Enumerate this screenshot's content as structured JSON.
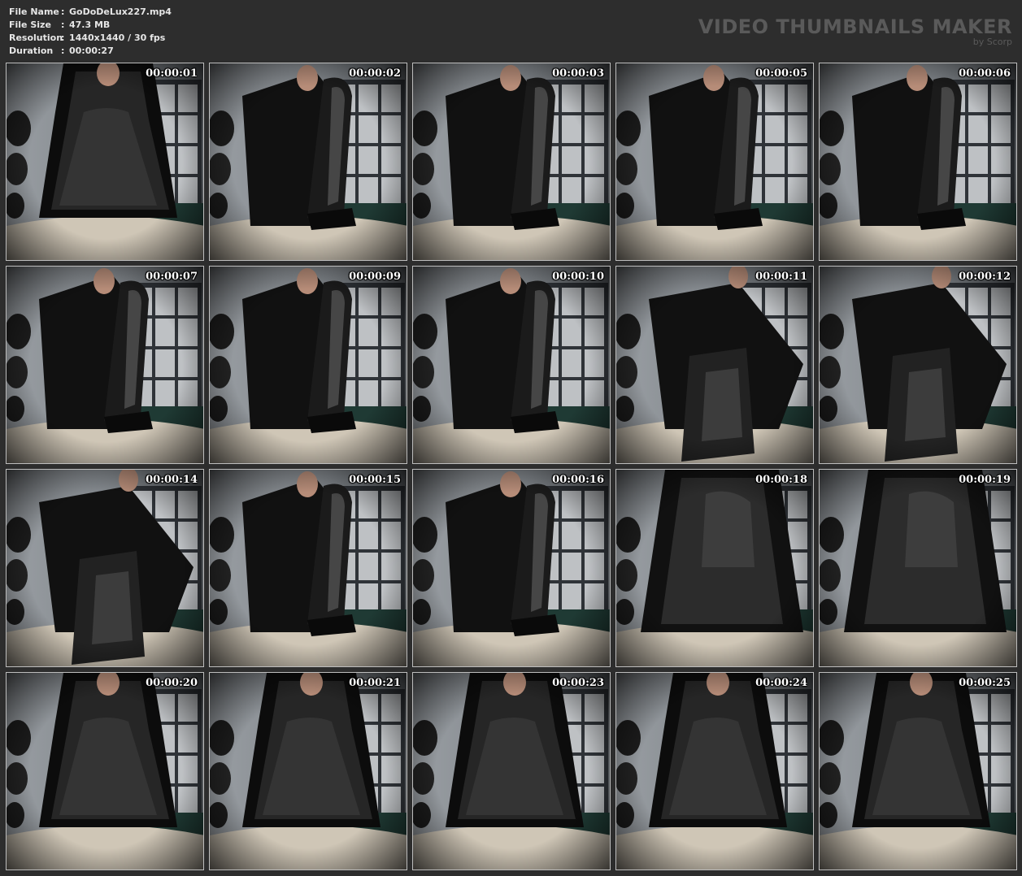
{
  "file_info": {
    "rows": [
      {
        "label": "File Name",
        "sep": ":",
        "value": "GoDoDeLux227.mp4"
      },
      {
        "label": "File Size",
        "sep": ":",
        "value": "47.3 MB"
      },
      {
        "label": "Resolution",
        "sep": ":",
        "value": "1440x1440 / 30 fps"
      },
      {
        "label": "Duration",
        "sep": ":",
        "value": "00:00:27"
      }
    ]
  },
  "brand": {
    "title": "VIDEO THUMBNAILS MAKER",
    "subtitle": "by Scorp"
  },
  "thumbnails": [
    {
      "timestamp": "00:00:01",
      "scene": "dress"
    },
    {
      "timestamp": "00:00:02",
      "scene": "boot-up"
    },
    {
      "timestamp": "00:00:03",
      "scene": "boot-up"
    },
    {
      "timestamp": "00:00:05",
      "scene": "boot-up"
    },
    {
      "timestamp": "00:00:06",
      "scene": "boot-up"
    },
    {
      "timestamp": "00:00:07",
      "scene": "boot-up"
    },
    {
      "timestamp": "00:00:09",
      "scene": "boot-up"
    },
    {
      "timestamp": "00:00:10",
      "scene": "boot-up"
    },
    {
      "timestamp": "00:00:11",
      "scene": "boot-close"
    },
    {
      "timestamp": "00:00:12",
      "scene": "boot-close"
    },
    {
      "timestamp": "00:00:14",
      "scene": "boot-close"
    },
    {
      "timestamp": "00:00:15",
      "scene": "boot-up"
    },
    {
      "timestamp": "00:00:16",
      "scene": "boot-up"
    },
    {
      "timestamp": "00:00:18",
      "scene": "coat"
    },
    {
      "timestamp": "00:00:19",
      "scene": "coat"
    },
    {
      "timestamp": "00:00:20",
      "scene": "dress"
    },
    {
      "timestamp": "00:00:21",
      "scene": "dress"
    },
    {
      "timestamp": "00:00:23",
      "scene": "dress"
    },
    {
      "timestamp": "00:00:24",
      "scene": "dress"
    },
    {
      "timestamp": "00:00:25",
      "scene": "dress"
    }
  ],
  "colors": {
    "background": "#2d2d2d",
    "info_text": "#e6e6e6",
    "brand_text": "#5a5a5a",
    "thumb_border": "#bdbdbd"
  }
}
